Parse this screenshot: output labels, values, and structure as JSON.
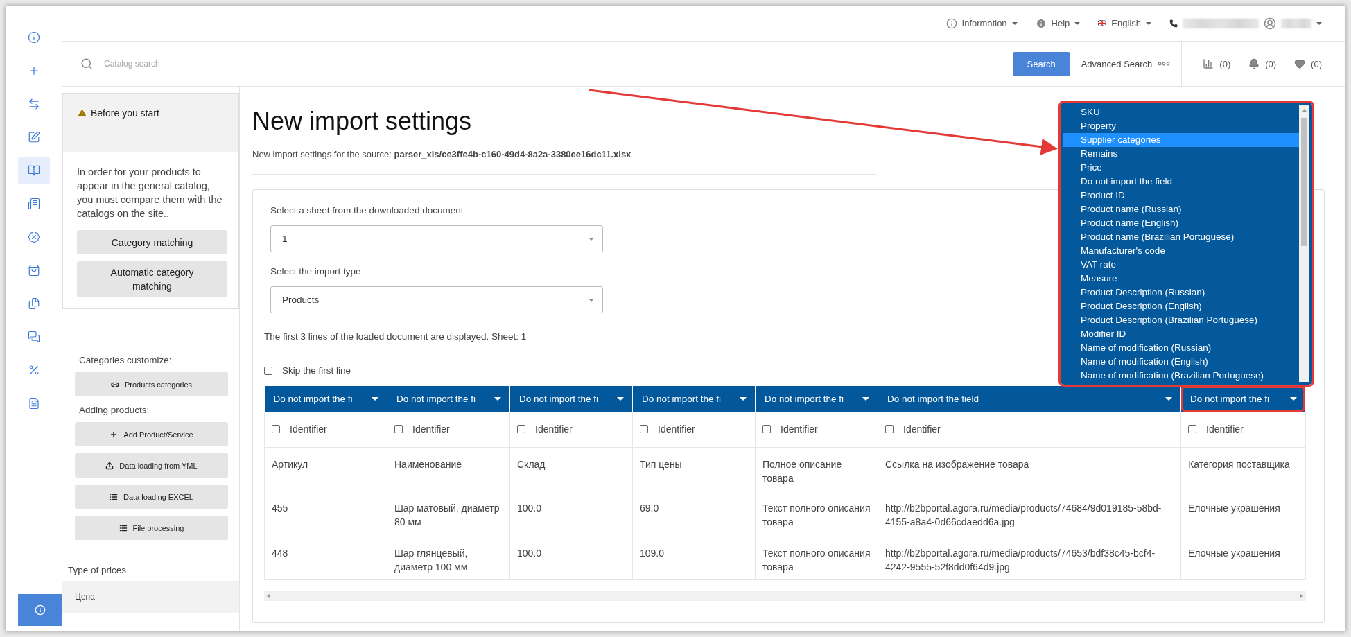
{
  "rail": [
    {
      "selected": false
    },
    {
      "selected": false
    },
    {
      "selected": false
    },
    {
      "selected": false
    },
    {
      "selected": true
    },
    {
      "selected": false
    },
    {
      "selected": false
    },
    {
      "selected": false
    },
    {
      "selected": false
    },
    {
      "selected": false
    },
    {
      "selected": false
    },
    {
      "selected": false
    }
  ],
  "top_bar": {
    "information": "Information",
    "help": "Help",
    "language": "English"
  },
  "search": {
    "placeholder": "Catalog search",
    "button": "Search",
    "advanced": "Advanced Search"
  },
  "counters": [
    "(0)",
    "(0)",
    "(0)"
  ],
  "left_panel": {
    "notice_title": "Before you start",
    "notice_text": "In order for your products to appear in the general catalog, you must compare them with the catalogs on the site..",
    "notice_buttons": [
      "Category matching",
      "Automatic category matching"
    ],
    "sections": [
      {
        "title": "Categories customize:",
        "buttons": [
          "Products categories"
        ]
      },
      {
        "title": "Adding products:",
        "buttons": [
          "Add Product/Service",
          "Data loading from YML",
          "Data loading EXCEL",
          "File processing"
        ]
      }
    ],
    "prices_title": "Type of prices",
    "prices": [
      {
        "label": "Цена",
        "selected": true
      }
    ]
  },
  "page": {
    "title": "New import settings",
    "subtitle": "New import settings for the source: **parser_xls/ce3ffe4b-c160-49d4-8a2a-3380ee16dc11.xlsx**"
  },
  "form": {
    "sheet_label": "Select a sheet from the downloaded document",
    "sheet_value": "1",
    "type_label": "Select the import type",
    "type_value": "Products",
    "note": "The first 3 lines of the loaded document are displayed. Sheet: 1",
    "skip_label": "Skip the first line",
    "skip_checked": false
  },
  "table": {
    "columns": [
      {
        "header": "Do not import the fi",
        "highlighted": false,
        "identifier": "Identifier",
        "identifier_checked": false
      },
      {
        "header": "Do not import the fi",
        "highlighted": false,
        "identifier": "Identifier",
        "identifier_checked": false
      },
      {
        "header": "Do not import the fi",
        "highlighted": false,
        "identifier": "Identifier",
        "identifier_checked": false
      },
      {
        "header": "Do not import the fi",
        "highlighted": false,
        "identifier": "Identifier",
        "identifier_checked": false
      },
      {
        "header": "Do not import the fi",
        "highlighted": false,
        "identifier": "Identifier",
        "identifier_checked": false
      },
      {
        "header": "Do not import the field",
        "highlighted": false,
        "identifier": "Identifier",
        "identifier_checked": false
      },
      {
        "header": "Do not import the fi",
        "highlighted": true,
        "identifier": "Identifier",
        "identifier_checked": false
      }
    ],
    "rows": [
      [
        "Артикул",
        "Наименование",
        "Склад",
        "Тип цены",
        "Полное описание товара",
        "Ссылка на изображение товара",
        "Категория поставщика"
      ],
      [
        "455",
        "Шар матовый, диаметр 80 мм",
        "100.0",
        "69.0",
        "Текст полного описания товара",
        "http://b2bportal.agora.ru/media/products/74684/9d019185-58bd-4155-a8a4-0d66cdaedd6a.jpg",
        "Елочные украшения"
      ],
      [
        "448",
        "Шар глянцевый, диаметр 100 мм",
        "100.0",
        "109.0",
        "Текст полного описания товара",
        "http://b2bportal.agora.ru/media/products/74653/bdf38c45-bcf4-4242-9555-52f8dd0f64d9.jpg",
        "Елочные украшения"
      ]
    ]
  },
  "dropdown": {
    "highlighted": true,
    "options": [
      {
        "label": "SKU",
        "selected": false
      },
      {
        "label": "Property",
        "selected": false
      },
      {
        "label": "Supplier categories",
        "selected": true
      },
      {
        "label": "Remains",
        "selected": false
      },
      {
        "label": "Price",
        "selected": false
      },
      {
        "label": "Do not import the field",
        "selected": false
      },
      {
        "label": "Product ID",
        "selected": false
      },
      {
        "label": "Product name (Russian)",
        "selected": false
      },
      {
        "label": "Product name (English)",
        "selected": false
      },
      {
        "label": "Product name (Brazilian Portuguese)",
        "selected": false
      },
      {
        "label": "Manufacturer's code",
        "selected": false
      },
      {
        "label": "VAT rate",
        "selected": false
      },
      {
        "label": "Measure",
        "selected": false
      },
      {
        "label": "Product Description (Russian)",
        "selected": false
      },
      {
        "label": "Product Description (English)",
        "selected": false
      },
      {
        "label": "Product Description (Brazilian Portuguese)",
        "selected": false
      },
      {
        "label": "Modifier ID",
        "selected": false
      },
      {
        "label": "Name of modification (Russian)",
        "selected": false
      },
      {
        "label": "Name of modification (English)",
        "selected": false
      },
      {
        "label": "Name of modification (Brazilian Portuguese)",
        "selected": false
      }
    ]
  }
}
